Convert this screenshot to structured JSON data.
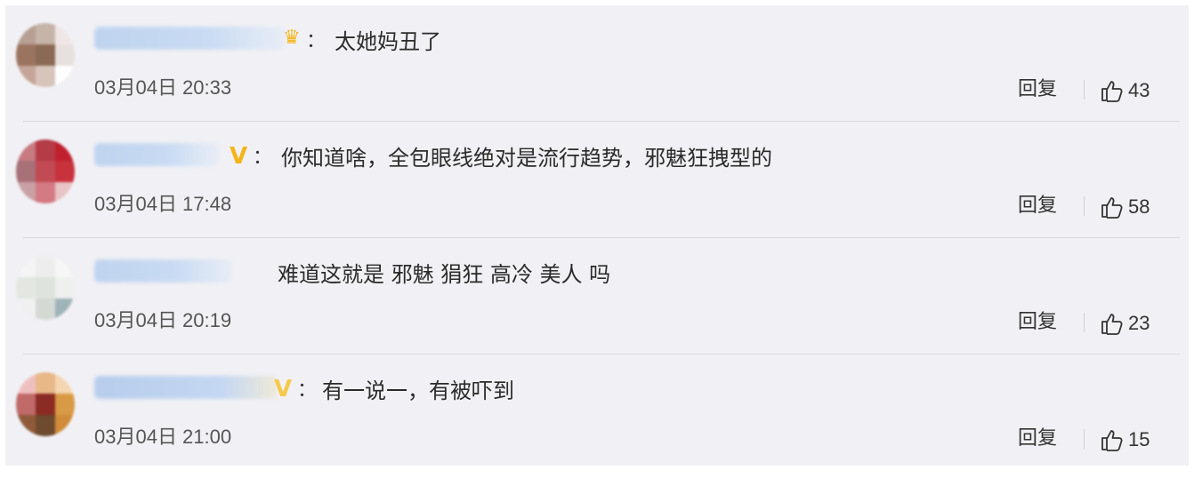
{
  "comments": [
    {
      "badge": "crown",
      "colon": "：",
      "text": "太她妈丑了",
      "time": "03月04日 20:33",
      "reply_label": "回复",
      "likes": "43",
      "avatar_colors": [
        "#b79f94",
        "#c7b4a8",
        "#f0e6e6",
        "#9b7460",
        "#8a6a55",
        "#e8e0de",
        "#c5a597",
        "#d7c4bb",
        "#ffffff"
      ]
    },
    {
      "badge": "V",
      "colon": "：",
      "text": "你知道啥，全包眼线绝对是流行趋势，邪魅狂拽型的",
      "time": "03月04日 17:48",
      "reply_label": "回复",
      "likes": "58",
      "avatar_colors": [
        "#c77a80",
        "#b53b47",
        "#c0202d",
        "#a87077",
        "#c24a54",
        "#c8323c",
        "#c9a0a4",
        "#d47a82",
        "#e9c4c6"
      ]
    },
    {
      "badge": "",
      "colon": "",
      "text": "难道这就是 邪魅 狷狂 高冷 美人 吗",
      "time": "03月04日 20:19",
      "reply_label": "回复",
      "likes": "23",
      "avatar_colors": [
        "#f4f4f4",
        "#ededed",
        "#f6f6f6",
        "#e4e6e2",
        "#dfe3dd",
        "#eef0ee",
        "#f0f0f0",
        "#d5d9d4",
        "#9fb4b8"
      ]
    },
    {
      "badge": "V",
      "colon": "：",
      "text": "有一说一，有被吓到",
      "time": "03月04日 21:00",
      "reply_label": "回复",
      "likes": "15",
      "avatar_colors": [
        "#f0c0c0",
        "#e8b888",
        "#f4d6b2",
        "#c06a6a",
        "#8c2a24",
        "#d89a45",
        "#8e5a3a",
        "#6e4a2e",
        "#d08c3a"
      ]
    }
  ],
  "colors": {
    "background": "#f1f1f5",
    "badge_gold": "#f3b51b",
    "username_blur": "#bfd3ef"
  }
}
